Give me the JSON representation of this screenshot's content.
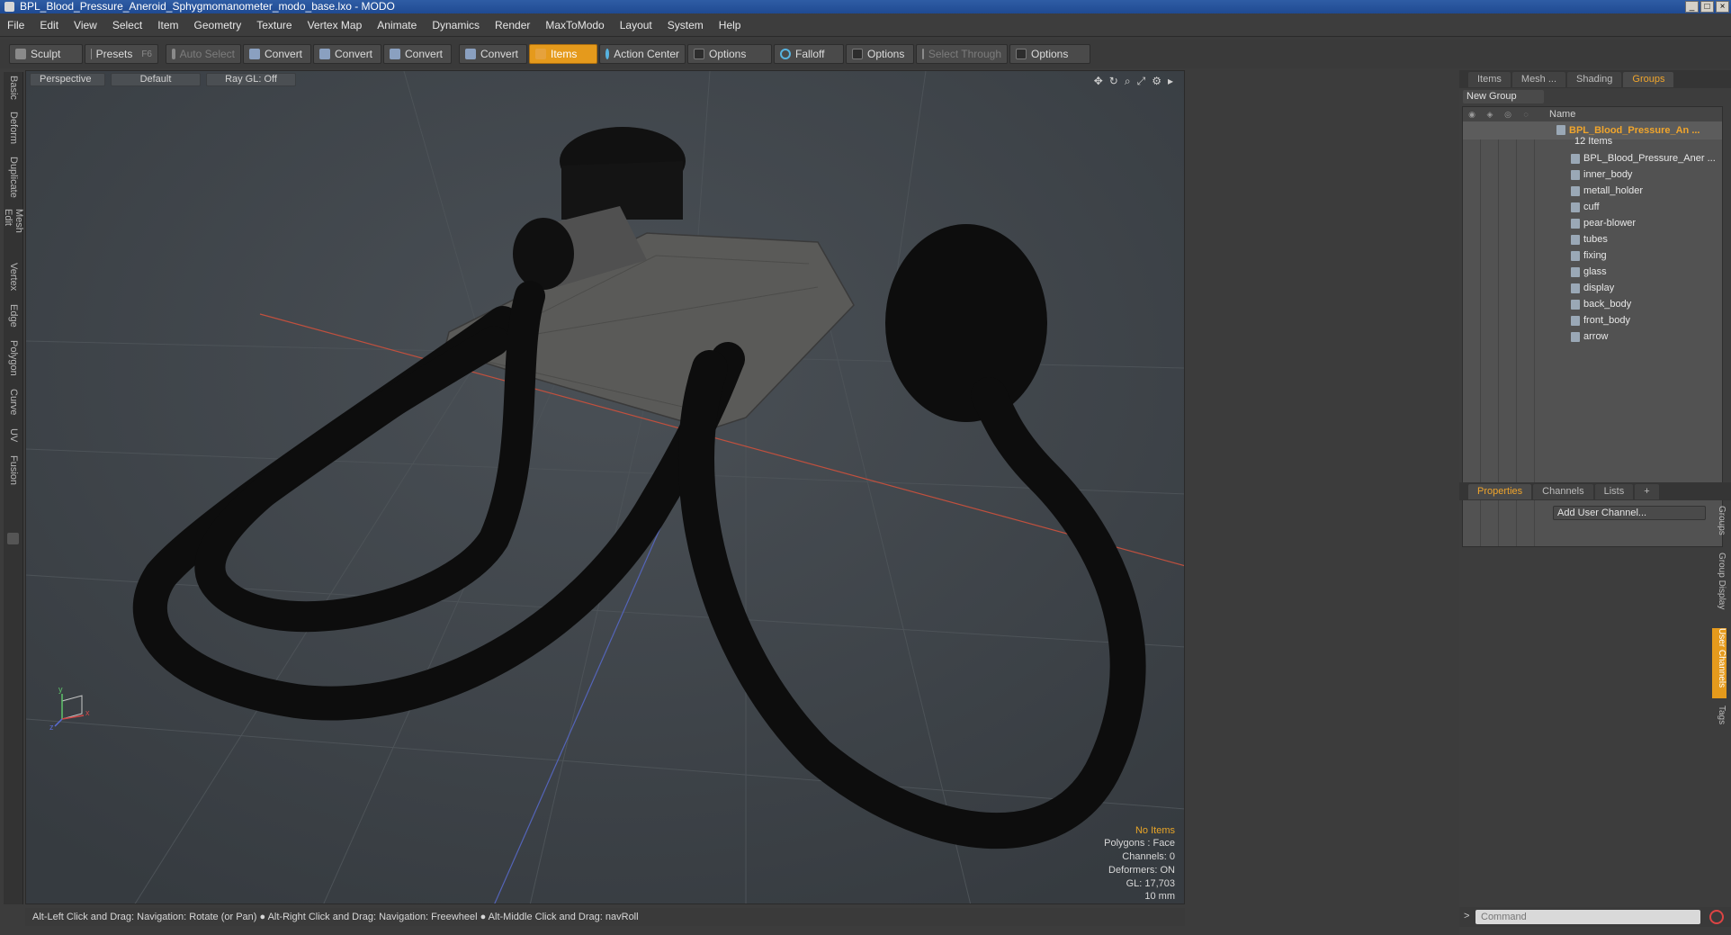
{
  "window": {
    "title": "BPL_Blood_Pressure_Aneroid_Sphygmomanometer_modo_base.lxo - MODO"
  },
  "menu": [
    "File",
    "Edit",
    "View",
    "Select",
    "Item",
    "Geometry",
    "Texture",
    "Vertex Map",
    "Animate",
    "Dynamics",
    "Render",
    "MaxToModo",
    "Layout",
    "System",
    "Help"
  ],
  "toolbar": {
    "sculpt": "Sculpt",
    "presets": "Presets",
    "presets_key": "F6",
    "auto_select": "Auto Select",
    "convert": "Convert",
    "items": "Items",
    "action_center": "Action Center",
    "options": "Options",
    "falloff": "Falloff",
    "select_through": "Select Through"
  },
  "left_tabs": [
    "Basic",
    "Deform",
    "Duplicate",
    "Mesh Edit",
    "Vertex",
    "Edge",
    "Polygon",
    "Curve",
    "UV",
    "Fusion"
  ],
  "viewport": {
    "view": "Perspective",
    "shading": "Default",
    "raygl": "Ray GL: Off",
    "stats": {
      "no_items": "No Items",
      "polygons": "Polygons : Face",
      "channels": "Channels: 0",
      "deformers": "Deformers: ON",
      "gl": "GL: 17,703",
      "scale": "10 mm"
    }
  },
  "status": "Alt-Left Click and Drag: Navigation: Rotate (or Pan) ●  Alt-Right Click and Drag: Navigation: Freewheel ●  Alt-Middle Click and Drag: navRoll",
  "right_panel": {
    "tabs": [
      "Items",
      "Mesh ...",
      "Shading",
      "Groups"
    ],
    "new_group": "New Group",
    "name_header": "Name",
    "group_name": "BPL_Blood_Pressure_An ...",
    "group_count": "12 Items",
    "items": [
      "BPL_Blood_Pressure_Aner ...",
      "inner_body",
      "metall_holder",
      "cuff",
      "pear-blower",
      "tubes",
      "fixing",
      "glass",
      "display",
      "back_body",
      "front_body",
      "arrow"
    ],
    "props_tabs": [
      "Properties",
      "Channels",
      "Lists",
      "+"
    ],
    "add_user_channel": "Add User Channel...",
    "vtabs": [
      "Groups",
      "Group Display",
      "User Channels",
      "Tags"
    ],
    "command_placeholder": "Command"
  }
}
